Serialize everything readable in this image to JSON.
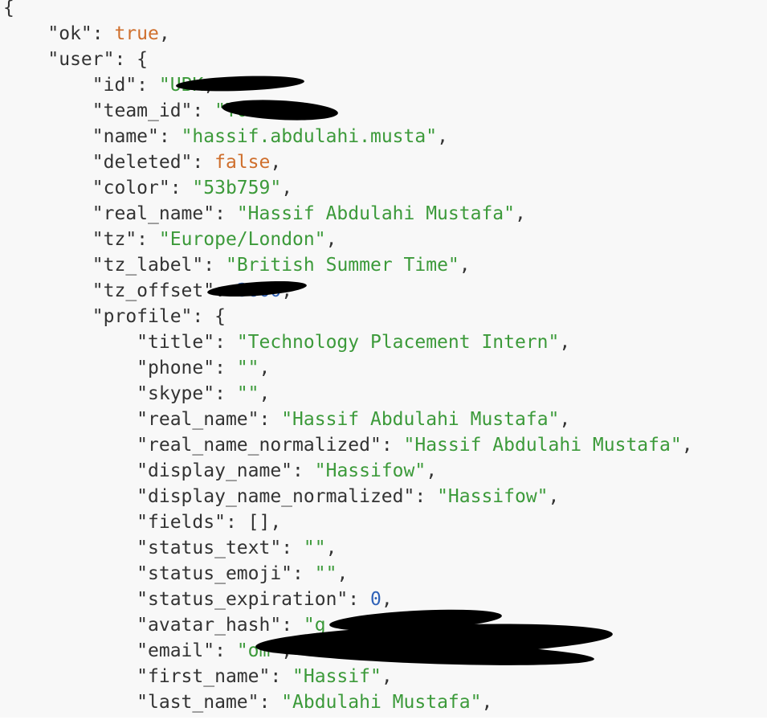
{
  "json_view": {
    "lines": [
      [
        {
          "t": "punct",
          "v": "{"
        }
      ],
      [
        {
          "t": "indent",
          "v": "    "
        },
        {
          "t": "key",
          "v": "\"ok\""
        },
        {
          "t": "punct",
          "v": ": "
        },
        {
          "t": "bool",
          "v": "true"
        },
        {
          "t": "punct",
          "v": ","
        }
      ],
      [
        {
          "t": "indent",
          "v": "    "
        },
        {
          "t": "key",
          "v": "\"user\""
        },
        {
          "t": "punct",
          "v": ": {"
        }
      ],
      [
        {
          "t": "indent",
          "v": "        "
        },
        {
          "t": "key",
          "v": "\"id\""
        },
        {
          "t": "punct",
          "v": ": "
        },
        {
          "t": "string",
          "v": "\"UBK"
        },
        {
          "t": "punct",
          "v": ","
        }
      ],
      [
        {
          "t": "indent",
          "v": "        "
        },
        {
          "t": "key",
          "v": "\"team_id\""
        },
        {
          "t": "punct",
          "v": ": "
        },
        {
          "t": "string",
          "v": "\"T0"
        },
        {
          "t": "string",
          "v": "X\""
        },
        {
          "t": "punct",
          "v": ","
        }
      ],
      [
        {
          "t": "indent",
          "v": "        "
        },
        {
          "t": "key",
          "v": "\"name\""
        },
        {
          "t": "punct",
          "v": ": "
        },
        {
          "t": "string",
          "v": "\"hassif.abdulahi.musta\""
        },
        {
          "t": "punct",
          "v": ","
        }
      ],
      [
        {
          "t": "indent",
          "v": "        "
        },
        {
          "t": "key",
          "v": "\"deleted\""
        },
        {
          "t": "punct",
          "v": ": "
        },
        {
          "t": "bool",
          "v": "false"
        },
        {
          "t": "punct",
          "v": ","
        }
      ],
      [
        {
          "t": "indent",
          "v": "        "
        },
        {
          "t": "key",
          "v": "\"color\""
        },
        {
          "t": "punct",
          "v": ": "
        },
        {
          "t": "string",
          "v": "\"53b759\""
        },
        {
          "t": "punct",
          "v": ","
        }
      ],
      [
        {
          "t": "indent",
          "v": "        "
        },
        {
          "t": "key",
          "v": "\"real_name\""
        },
        {
          "t": "punct",
          "v": ": "
        },
        {
          "t": "string",
          "v": "\"Hassif Abdulahi Mustafa\""
        },
        {
          "t": "punct",
          "v": ","
        }
      ],
      [
        {
          "t": "indent",
          "v": "        "
        },
        {
          "t": "key",
          "v": "\"tz\""
        },
        {
          "t": "punct",
          "v": ": "
        },
        {
          "t": "string",
          "v": "\"Europe/London\""
        },
        {
          "t": "punct",
          "v": ","
        }
      ],
      [
        {
          "t": "indent",
          "v": "        "
        },
        {
          "t": "key",
          "v": "\"tz_label\""
        },
        {
          "t": "punct",
          "v": ": "
        },
        {
          "t": "string",
          "v": "\"British Summer Time\""
        },
        {
          "t": "punct",
          "v": ","
        }
      ],
      [
        {
          "t": "indent",
          "v": "        "
        },
        {
          "t": "key",
          "v": "\"tz_offset\""
        },
        {
          "t": "punct",
          "v": ": "
        },
        {
          "t": "number",
          "v": "3600"
        },
        {
          "t": "punct",
          "v": ","
        }
      ],
      [
        {
          "t": "indent",
          "v": "        "
        },
        {
          "t": "key",
          "v": "\"profile\""
        },
        {
          "t": "punct",
          "v": ": {"
        }
      ],
      [
        {
          "t": "indent",
          "v": "            "
        },
        {
          "t": "key",
          "v": "\"title\""
        },
        {
          "t": "punct",
          "v": ": "
        },
        {
          "t": "string",
          "v": "\"Technology Placement Intern\""
        },
        {
          "t": "punct",
          "v": ","
        }
      ],
      [
        {
          "t": "indent",
          "v": "            "
        },
        {
          "t": "key",
          "v": "\"phone\""
        },
        {
          "t": "punct",
          "v": ": "
        },
        {
          "t": "string",
          "v": "\"\""
        },
        {
          "t": "punct",
          "v": ","
        }
      ],
      [
        {
          "t": "indent",
          "v": "            "
        },
        {
          "t": "key",
          "v": "\"skype\""
        },
        {
          "t": "punct",
          "v": ": "
        },
        {
          "t": "string",
          "v": "\"\""
        },
        {
          "t": "punct",
          "v": ","
        }
      ],
      [
        {
          "t": "indent",
          "v": "            "
        },
        {
          "t": "key",
          "v": "\"real_name\""
        },
        {
          "t": "punct",
          "v": ": "
        },
        {
          "t": "string",
          "v": "\"Hassif Abdulahi Mustafa\""
        },
        {
          "t": "punct",
          "v": ","
        }
      ],
      [
        {
          "t": "indent",
          "v": "            "
        },
        {
          "t": "key",
          "v": "\"real_name_normalized\""
        },
        {
          "t": "punct",
          "v": ": "
        },
        {
          "t": "string",
          "v": "\"Hassif Abdulahi Mustafa\""
        },
        {
          "t": "punct",
          "v": ","
        }
      ],
      [
        {
          "t": "indent",
          "v": "            "
        },
        {
          "t": "key",
          "v": "\"display_name\""
        },
        {
          "t": "punct",
          "v": ": "
        },
        {
          "t": "string",
          "v": "\"Hassifow\""
        },
        {
          "t": "punct",
          "v": ","
        }
      ],
      [
        {
          "t": "indent",
          "v": "            "
        },
        {
          "t": "key",
          "v": "\"display_name_normalized\""
        },
        {
          "t": "punct",
          "v": ": "
        },
        {
          "t": "string",
          "v": "\"Hassifow\""
        },
        {
          "t": "punct",
          "v": ","
        }
      ],
      [
        {
          "t": "indent",
          "v": "            "
        },
        {
          "t": "key",
          "v": "\"fields\""
        },
        {
          "t": "punct",
          "v": ": []"
        },
        {
          "t": "punct",
          "v": ","
        }
      ],
      [
        {
          "t": "indent",
          "v": "            "
        },
        {
          "t": "key",
          "v": "\"status_text\""
        },
        {
          "t": "punct",
          "v": ": "
        },
        {
          "t": "string",
          "v": "\"\""
        },
        {
          "t": "punct",
          "v": ","
        }
      ],
      [
        {
          "t": "indent",
          "v": "            "
        },
        {
          "t": "key",
          "v": "\"status_emoji\""
        },
        {
          "t": "punct",
          "v": ": "
        },
        {
          "t": "string",
          "v": "\"\""
        },
        {
          "t": "punct",
          "v": ","
        }
      ],
      [
        {
          "t": "indent",
          "v": "            "
        },
        {
          "t": "key",
          "v": "\"status_expiration\""
        },
        {
          "t": "punct",
          "v": ": "
        },
        {
          "t": "number",
          "v": "0"
        },
        {
          "t": "punct",
          "v": ","
        }
      ],
      [
        {
          "t": "indent",
          "v": "            "
        },
        {
          "t": "key",
          "v": "\"avatar_hash\""
        },
        {
          "t": "punct",
          "v": ": "
        },
        {
          "t": "string",
          "v": "\"g"
        }
      ],
      [
        {
          "t": "indent",
          "v": "            "
        },
        {
          "t": "key",
          "v": "\"email\""
        },
        {
          "t": "punct",
          "v": ": "
        },
        {
          "t": "string",
          "v": "\""
        },
        {
          "t": "string",
          "v": "om\""
        },
        {
          "t": "punct",
          "v": ","
        }
      ],
      [
        {
          "t": "indent",
          "v": "            "
        },
        {
          "t": "key",
          "v": "\"first_name\""
        },
        {
          "t": "punct",
          "v": ": "
        },
        {
          "t": "string",
          "v": "\"Hassif\""
        },
        {
          "t": "punct",
          "v": ","
        }
      ],
      [
        {
          "t": "indent",
          "v": "            "
        },
        {
          "t": "key",
          "v": "\"last_name\""
        },
        {
          "t": "punct",
          "v": ": "
        },
        {
          "t": "string",
          "v": "\"Abdulahi Mustafa\""
        },
        {
          "t": "punct",
          "v": ","
        }
      ]
    ]
  },
  "colors": {
    "background": "#f8f8f8",
    "key": "#333333",
    "string": "#3c9a3a",
    "boolean": "#cf6f2d",
    "number": "#2f62b8",
    "redaction": "#000000"
  }
}
